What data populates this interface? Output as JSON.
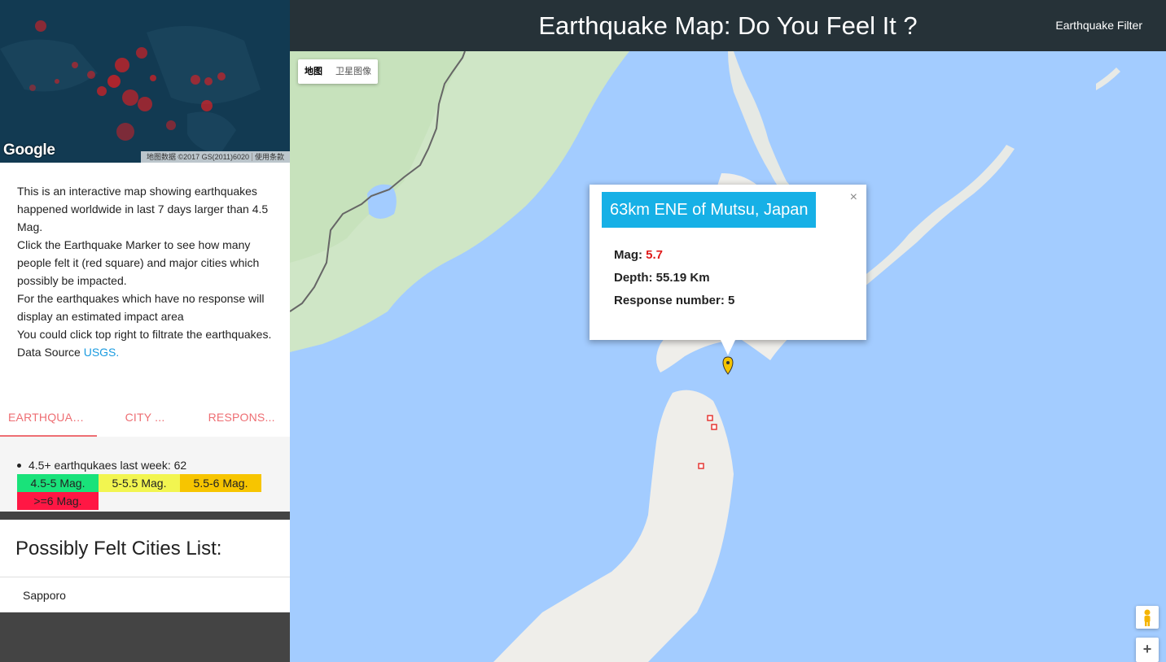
{
  "header": {
    "title": "Earthquake Map: Do You Feel It ?",
    "filter_label": "Earthquake Filter"
  },
  "minimap": {
    "logo": "Google",
    "attribution": "地图数据 ©2017 GS(2011)6020",
    "terms": "使用条款"
  },
  "description": {
    "line1": "This is an interactive map showing earthquakes happened worldwide in last 7 days larger than 4.5 Mag.",
    "line2": "Click the Earthquake Marker to see how many people felt it (red square) and major cities which possibly be impacted.",
    "line3": "For the earthquakes which have no response will display an estimated impact area",
    "line4": "You could click top right to filtrate the earthquakes.",
    "source_prefix": "Data Source ",
    "source_link": "USGS."
  },
  "tabs": [
    {
      "label": "EARTHQUAK..."
    },
    {
      "label": "CITY ..."
    },
    {
      "label": "RESPONS..."
    }
  ],
  "legend": {
    "count_text": "4.5+ earthqukaes last week: 62",
    "items": [
      {
        "label": "4.5-5 Mag.",
        "color": "#19e27a"
      },
      {
        "label": "5-5.5 Mag.",
        "color": "#f2f550"
      },
      {
        "label": "5.5-6 Mag.",
        "color": "#f7c500"
      },
      {
        "label": ">=6 Mag.",
        "color": "#ff1744"
      }
    ]
  },
  "felt_cities": {
    "title": "Possibly Felt Cities List:",
    "items": [
      "Sapporo"
    ]
  },
  "map": {
    "type_map": "地图",
    "type_satellite": "卫星图像",
    "zoom_in": "+",
    "pegman_icon": "pegman-icon",
    "marker_color": "#f5c400",
    "response_square_color": "#e53935"
  },
  "infowindow": {
    "title": "63km ENE of Mutsu, Japan",
    "mag_label": "Mag: ",
    "mag_value": "5.7",
    "depth_text": "Depth: 55.19 Km",
    "response_text": "Response number: 5",
    "close": "×"
  }
}
